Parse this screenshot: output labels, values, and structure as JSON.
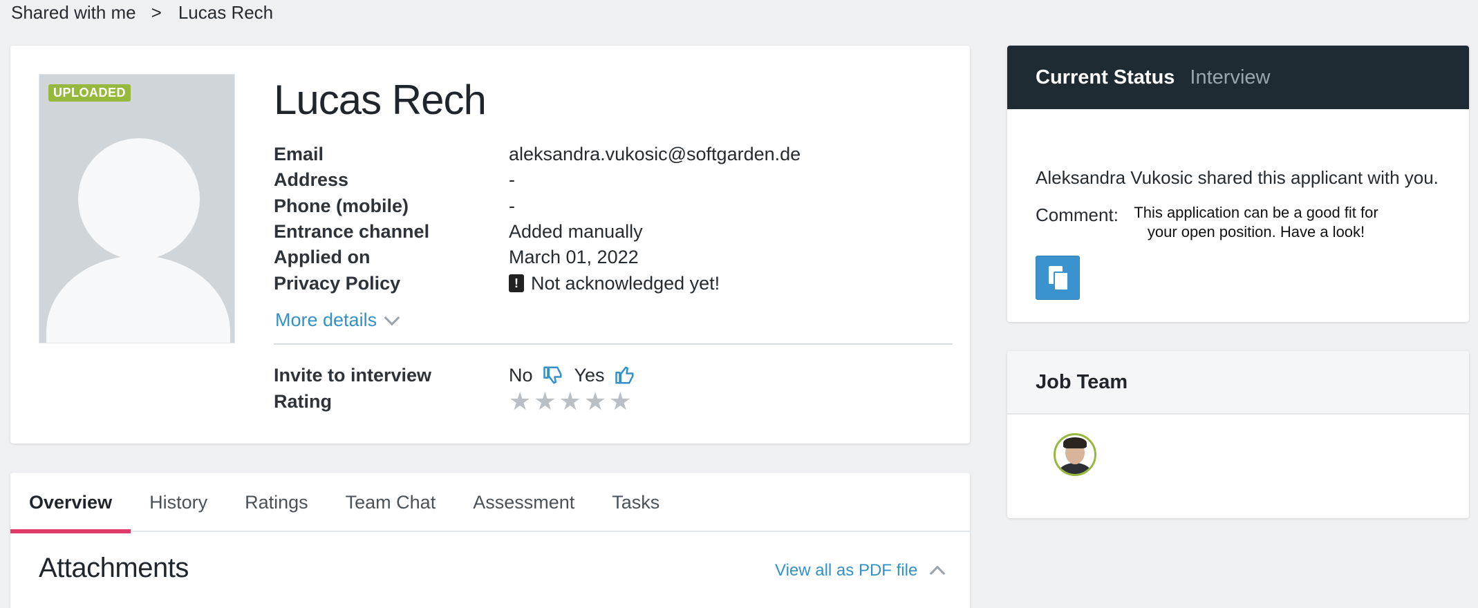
{
  "breadcrumb": {
    "root": "Shared with me",
    "separator": ">",
    "current": "Lucas Rech"
  },
  "applicant": {
    "badge": "UPLOADED",
    "name": "Lucas Rech",
    "fields": [
      {
        "label": "Email",
        "value": "aleksandra.vukosic@softgarden.de"
      },
      {
        "label": "Address",
        "value": "-"
      },
      {
        "label": "Phone (mobile)",
        "value": "-"
      },
      {
        "label": "Entrance channel",
        "value": "Added manually"
      },
      {
        "label": "Applied on",
        "value": "March 01, 2022"
      },
      {
        "label": "Privacy Policy",
        "value": "Not acknowledged yet!"
      }
    ],
    "more_details": "More details",
    "invite_label": "Invite to interview",
    "no_label": "No",
    "yes_label": "Yes",
    "rating_label": "Rating",
    "rating_value": 0,
    "rating_max": 5,
    "colors": {
      "warning": "#d9472b",
      "link": "#3292c7",
      "badge": "#96b83c"
    }
  },
  "tabs": [
    {
      "label": "Overview",
      "active": true
    },
    {
      "label": "History"
    },
    {
      "label": "Ratings"
    },
    {
      "label": "Team Chat"
    },
    {
      "label": "Assessment"
    },
    {
      "label": "Tasks"
    }
  ],
  "attachments": {
    "title": "Attachments",
    "pdf_link": "View all as PDF file"
  },
  "status": {
    "title": "Current Status",
    "value": "Interview",
    "shared_text": "Aleksandra Vukosic shared this applicant with you.",
    "comment_label": "Comment:",
    "comment_text": "This application can be a good fit for your open position. Have a look!"
  },
  "job_team": {
    "title": "Job Team"
  },
  "icons": {
    "thumbs_down": "thumbs-down-icon",
    "thumbs_up": "thumbs-up-icon",
    "copy": "copy-icon",
    "warning": "document-alert-icon"
  }
}
